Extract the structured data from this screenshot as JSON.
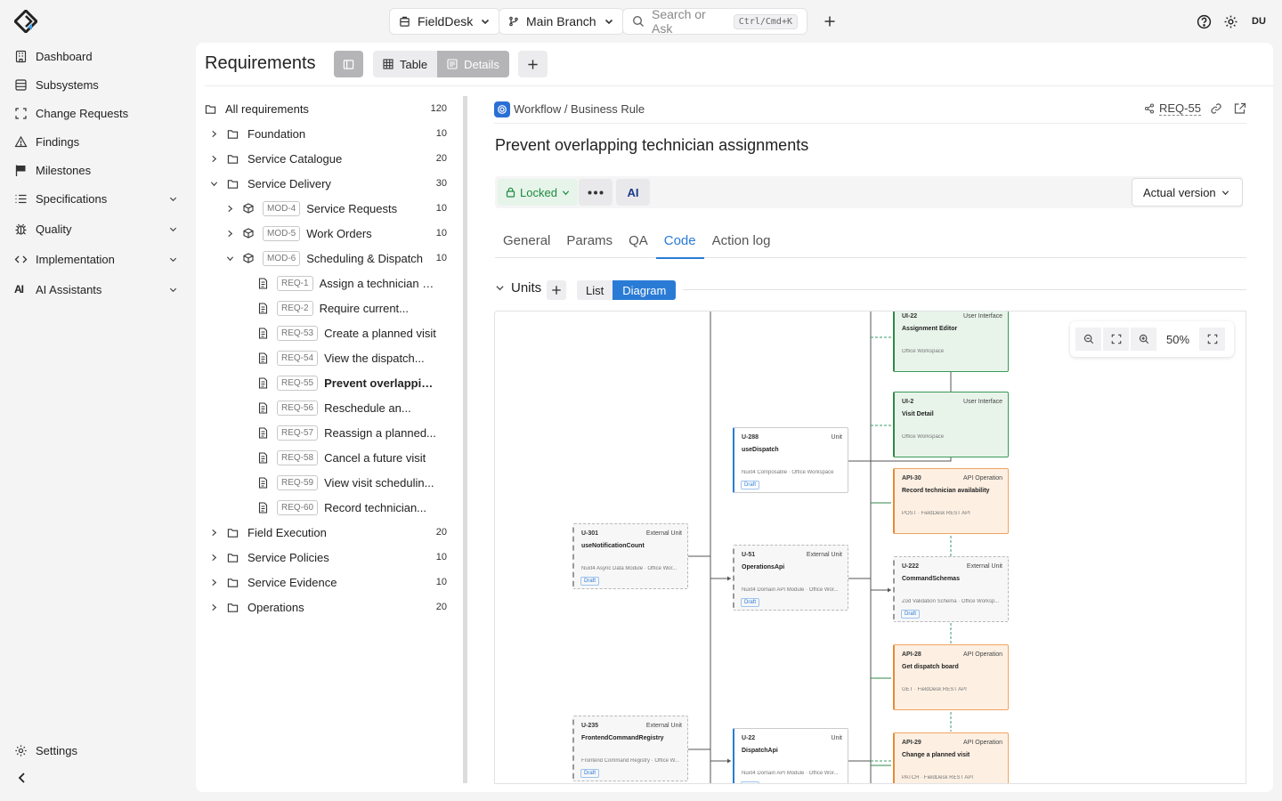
{
  "topbar": {
    "project": "FieldDesk",
    "branch": "Main Branch",
    "search_placeholder": "Search or Ask",
    "search_shortcut": "Ctrl/Cmd+K",
    "user_initials": "DU"
  },
  "sidebar": {
    "items": [
      {
        "label": "Dashboard",
        "icon": "building-icon"
      },
      {
        "label": "Subsystems",
        "icon": "database-icon"
      },
      {
        "label": "Change Requests",
        "icon": "frame-icon"
      },
      {
        "label": "Findings",
        "icon": "warning-triangle-icon"
      },
      {
        "label": "Milestones",
        "icon": "flag-icon"
      },
      {
        "label": "Specifications",
        "icon": "list-icon"
      },
      {
        "label": "Quality",
        "icon": "bug-icon"
      },
      {
        "label": "Implementation",
        "icon": "code-icon"
      },
      {
        "label": "AI Assistants",
        "icon": "ai-icon"
      }
    ],
    "settings": "Settings"
  },
  "page": {
    "title": "Requirements",
    "view_table": "Table",
    "view_details": "Details"
  },
  "tree": {
    "root": {
      "label": "All requirements",
      "count": "120"
    },
    "folders_top": [
      {
        "label": "Foundation",
        "count": "10"
      },
      {
        "label": "Service Catalogue",
        "count": "20"
      },
      {
        "label": "Service Delivery",
        "count": "30"
      }
    ],
    "modules": [
      {
        "badge": "MOD-4",
        "label": "Service Requests",
        "count": "10"
      },
      {
        "badge": "MOD-5",
        "label": "Work Orders",
        "count": "10"
      },
      {
        "badge": "MOD-6",
        "label": "Scheduling & Dispatch",
        "count": "10"
      }
    ],
    "reqs": [
      {
        "badge": "REQ-1",
        "label": "Assign a technician to..."
      },
      {
        "badge": "REQ-2",
        "label": "Require current..."
      },
      {
        "badge": "REQ-53",
        "label": "Create a planned visit"
      },
      {
        "badge": "REQ-54",
        "label": "View the dispatch..."
      },
      {
        "badge": "REQ-55",
        "label": "Prevent overlapping..."
      },
      {
        "badge": "REQ-56",
        "label": "Reschedule an..."
      },
      {
        "badge": "REQ-57",
        "label": "Reassign a planned..."
      },
      {
        "badge": "REQ-58",
        "label": "Cancel a future visit"
      },
      {
        "badge": "REQ-59",
        "label": "View visit schedulin..."
      },
      {
        "badge": "REQ-60",
        "label": "Record technician..."
      }
    ],
    "folders_bottom": [
      {
        "label": "Field Execution",
        "count": "20"
      },
      {
        "label": "Service Policies",
        "count": "10"
      },
      {
        "label": "Service Evidence",
        "count": "10"
      },
      {
        "label": "Operations",
        "count": "20"
      }
    ]
  },
  "detail": {
    "breadcrumb": "Workflow / Business Rule",
    "req_id": "REQ-55",
    "title": "Prevent overlapping technician assignments",
    "status": "Locked",
    "ai_label": "AI",
    "version": "Actual version",
    "tabs": [
      "General",
      "Params",
      "QA",
      "Code",
      "Action log"
    ],
    "units_label": "Units",
    "toggle_list": "List",
    "toggle_diagram": "Diagram",
    "zoom": "50%"
  },
  "diagram": {
    "nodes": [
      {
        "id": "UI-22",
        "type": "User Interface",
        "name": "Assignment Editor",
        "sub": "Office Workspace",
        "kind": "ui"
      },
      {
        "id": "UI-2",
        "type": "User Interface",
        "name": "Visit Detail",
        "sub": "Office Workspace",
        "kind": "ui"
      },
      {
        "id": "U-288",
        "type": "Unit",
        "name": "useDispatch",
        "sub": "Nuxt4 Composable · Office Workspace",
        "draft": "Draft",
        "kind": "unit"
      },
      {
        "id": "API-30",
        "type": "API Operation",
        "name": "Record technician availability",
        "sub": "POST · FieldDesk REST API",
        "kind": "api"
      },
      {
        "id": "U-301",
        "type": "External Unit",
        "name": "useNotificationCount",
        "sub": "Nuxt4 Async Data Module · Office Wor...",
        "draft": "Draft",
        "kind": "ext"
      },
      {
        "id": "U-51",
        "type": "External Unit",
        "name": "OperationsApi",
        "sub": "Nuxt4 Domain API Module · Office Wor...",
        "draft": "Draft",
        "kind": "ext"
      },
      {
        "id": "U-222",
        "type": "External Unit",
        "name": "CommandSchemas",
        "sub": "Zod Validation Schema · Office Worksp...",
        "draft": "Draft",
        "kind": "ext"
      },
      {
        "id": "API-28",
        "type": "API Operation",
        "name": "Get dispatch board",
        "sub": "GET · FieldDesk REST API",
        "kind": "api"
      },
      {
        "id": "U-235",
        "type": "External Unit",
        "name": "FrontendCommandRegistry",
        "sub": "Frontend Command Registry · Office W...",
        "draft": "Draft",
        "kind": "ext"
      },
      {
        "id": "U-22",
        "type": "Unit",
        "name": "DispatchApi",
        "sub": "Nuxt4 Domain API Module · Office Wor...",
        "draft": "Draft",
        "kind": "unit"
      },
      {
        "id": "API-29",
        "type": "API Operation",
        "name": "Change a planned visit",
        "sub": "PATCH · FieldDesk REST API",
        "kind": "api"
      }
    ]
  }
}
